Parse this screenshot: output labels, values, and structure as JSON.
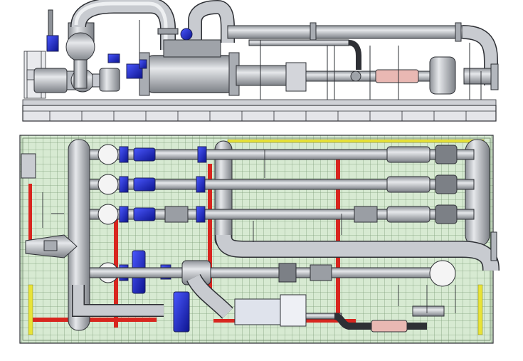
{
  "figure": {
    "views": [
      {
        "id": "elevation",
        "kind": "side-elevation"
      },
      {
        "id": "plan",
        "kind": "top-plan"
      }
    ],
    "colors": {
      "pipe": "#bfc3c9",
      "pipe_edge": "#3a3d42",
      "valve_blue": "#1f2ed6",
      "skid_grating": "#cfe6c9",
      "grating_line": "#7f9f7a",
      "red_beam": "#d8261f",
      "yellow_beam": "#e8e337",
      "flange_white": "#f4f4f4",
      "filter_pink": "#e9b8b3",
      "frame": "#d9dadf"
    },
    "icons": [
      "valve-icon",
      "motor-icon",
      "pump-icon",
      "filter-icon",
      "flange-icon",
      "vessel-icon",
      "gauge-icon"
    ]
  }
}
